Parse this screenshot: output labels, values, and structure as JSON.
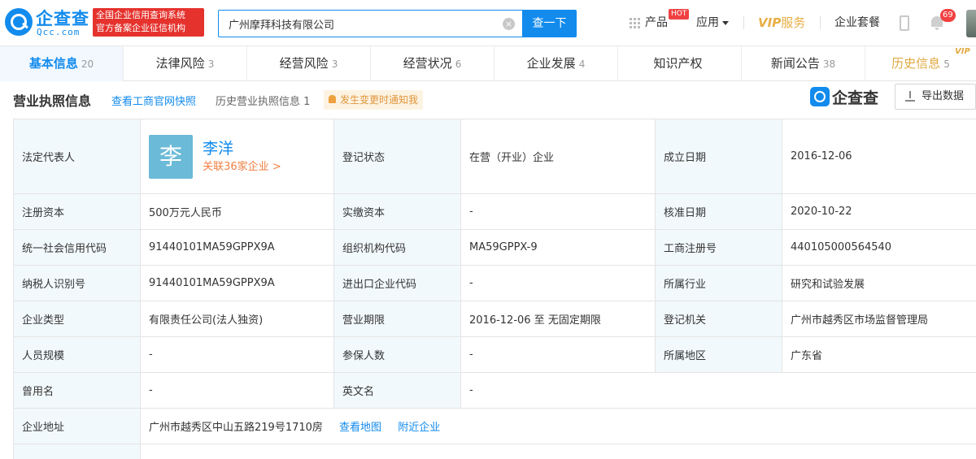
{
  "header": {
    "logo_cn": "企查查",
    "logo_en": "Qcc.com",
    "gov_badge_line1": "全国企业信用查询系统",
    "gov_badge_line2": "官方备案企业征信机构",
    "search_value": "广州摩拜科技有限公司",
    "search_button": "查一下",
    "nav_products": "产品",
    "hot_badge": "HOT",
    "nav_apps": "应用",
    "vip_label": "VIP",
    "vip_service": "服务",
    "nav_packages": "企业套餐",
    "notification_count": "69"
  },
  "tabs": [
    {
      "label": "基本信息",
      "count": "20"
    },
    {
      "label": "法律风险",
      "count": "3"
    },
    {
      "label": "经营风险",
      "count": "3"
    },
    {
      "label": "经营状况",
      "count": "6"
    },
    {
      "label": "企业发展",
      "count": "4"
    },
    {
      "label": "知识产权",
      "count": ""
    },
    {
      "label": "新闻公告",
      "count": "38"
    },
    {
      "label": "历史信息",
      "count": "5"
    }
  ],
  "tab_vip_corner": "VIP",
  "section": {
    "title": "营业执照信息",
    "link_official": "查看工商官网快照",
    "history_label": "历史营业执照信息",
    "history_count": "1",
    "notify_label": "发生变更时通知我",
    "qcc_logo_text": "企查查",
    "export_label": "导出数据"
  },
  "representative": {
    "label": "法定代表人",
    "avatar_char": "李",
    "name": "李洋",
    "related": "关联36家企业 >"
  },
  "fields": {
    "reg_status_label": "登记状态",
    "reg_status": "在营（开业）企业",
    "established_label": "成立日期",
    "established": "2016-12-06",
    "reg_capital_label": "注册资本",
    "reg_capital": "500万元人民币",
    "paid_capital_label": "实缴资本",
    "paid_capital": "-",
    "approval_date_label": "核准日期",
    "approval_date": "2020-10-22",
    "credit_code_label": "统一社会信用代码",
    "credit_code": "91440101MA59GPPX9A",
    "org_code_label": "组织机构代码",
    "org_code": "MA59GPPX-9",
    "biz_reg_no_label": "工商注册号",
    "biz_reg_no": "440105000564540",
    "taxpayer_id_label": "纳税人识别号",
    "taxpayer_id": "91440101MA59GPPX9A",
    "import_export_label": "进出口企业代码",
    "import_export": "-",
    "industry_label": "所属行业",
    "industry": "研究和试验发展",
    "company_type_label": "企业类型",
    "company_type": "有限责任公司(法人独资)",
    "business_term_label": "营业期限",
    "business_term": "2016-12-06 至 无固定期限",
    "reg_authority_label": "登记机关",
    "reg_authority": "广州市越秀区市场监督管理局",
    "staff_size_label": "人员规模",
    "staff_size": "-",
    "insured_label": "参保人数",
    "insured": "-",
    "region_label": "所属地区",
    "region": "广东省",
    "former_name_label": "曾用名",
    "former_name": "-",
    "english_name_label": "英文名",
    "english_name": "-",
    "address_label": "企业地址",
    "address": "广州市越秀区中山五路219号1710房",
    "view_map": "查看地图",
    "nearby": "附近企业"
  }
}
